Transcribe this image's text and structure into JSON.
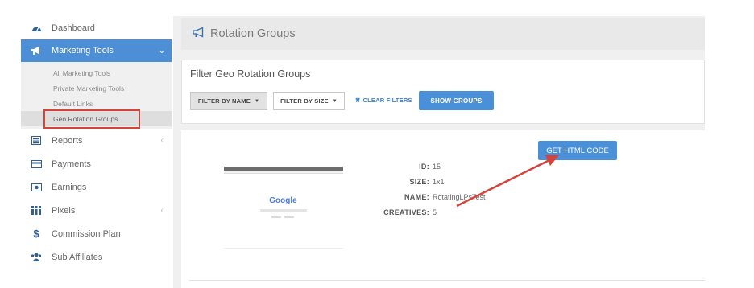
{
  "sidebar": {
    "items": [
      {
        "label": "Dashboard",
        "icon": "dashboard-icon"
      },
      {
        "label": "Marketing Tools",
        "icon": "megaphone-icon"
      },
      {
        "label": "Reports",
        "icon": "reports-icon"
      },
      {
        "label": "Payments",
        "icon": "credit-card-icon"
      },
      {
        "label": "Earnings",
        "icon": "money-icon"
      },
      {
        "label": "Pixels",
        "icon": "grid-icon"
      },
      {
        "label": "Commission Plan",
        "icon": "dollar-icon"
      },
      {
        "label": "Sub Affiliates",
        "icon": "users-icon"
      }
    ],
    "subitems": [
      "All Marketing Tools",
      "Private Marketing Tools",
      "Default Links",
      "Geo Rotation Groups"
    ]
  },
  "header": {
    "title": "Rotation Groups"
  },
  "filter": {
    "title": "Filter Geo Rotation Groups",
    "by_name": "FILTER BY NAME",
    "by_size": "FILTER BY SIZE",
    "clear": "CLEAR FILTERS",
    "show": "SHOW GROUPS"
  },
  "group": {
    "thumbnail_text": "Google",
    "labels": {
      "id": "ID:",
      "size": "SIZE:",
      "name": "NAME:",
      "creatives": "CREATIVES:"
    },
    "values": {
      "id": "15",
      "size": "1x1",
      "name": "RotatingLPsTest",
      "creatives": "5"
    },
    "get_html": "GET HTML CODE"
  },
  "colors": {
    "accent": "#4a90d9",
    "highlight": "#d5433a",
    "icon": "#2f5f93"
  }
}
